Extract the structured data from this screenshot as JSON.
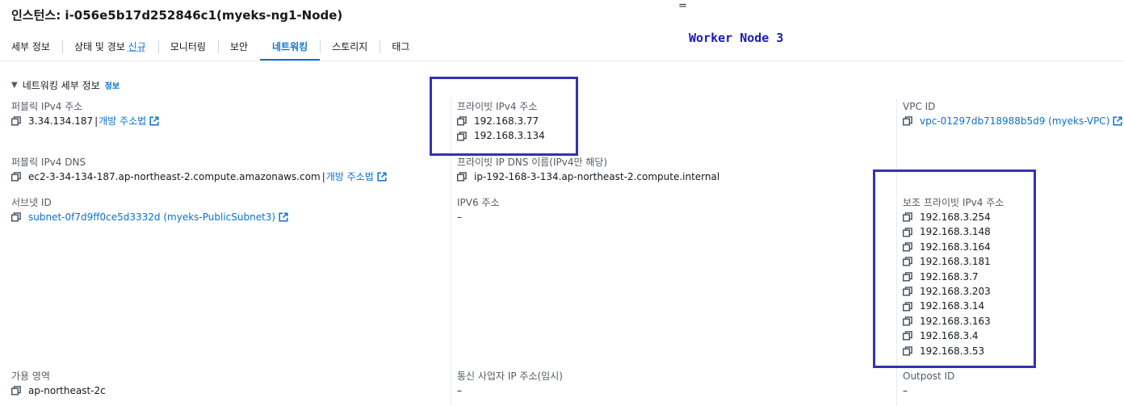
{
  "header": {
    "title": "인스턴스: i-056e5b17d252846c1(myeks-ng1-Node)",
    "top_symbol": "="
  },
  "annotation": "Worker Node 3",
  "tabs": [
    {
      "label": "세부 정보"
    },
    {
      "label": "상태 및 경보",
      "badge": "신규"
    },
    {
      "label": "모니터링"
    },
    {
      "label": "보안"
    },
    {
      "label": "네트워킹",
      "active": true
    },
    {
      "label": "스토리지"
    },
    {
      "label": "태그"
    }
  ],
  "section": {
    "title": "네트워킹 세부 정보",
    "info": "정보"
  },
  "common": {
    "open_address": "개방 주소법",
    "dash": "–"
  },
  "fields": {
    "public_ipv4": {
      "label": "퍼블릭 IPv4 주소",
      "value": "3.34.134.187"
    },
    "private_ipv4": {
      "label": "프라이빗 IPv4 주소",
      "values": [
        "192.168.3.77",
        "192.168.3.134"
      ]
    },
    "vpc_id": {
      "label": "VPC ID",
      "value": "vpc-01297db718988b5d9 (myeks-VPC)"
    },
    "public_dns": {
      "label": "퍼블릭 IPv4 DNS",
      "value": "ec2-3-34-134-187.ap-northeast-2.compute.amazonaws.com"
    },
    "private_dns": {
      "label": "프라이빗 IP DNS 이름(IPv4만 해당)",
      "value": "ip-192-168-3-134.ap-northeast-2.compute.internal"
    },
    "subnet_id": {
      "label": "서브넷 ID",
      "value": "subnet-0f7d9ff0ce5d3332d (myeks-PublicSubnet3)"
    },
    "ipv6": {
      "label": "IPV6 주소",
      "value": "–"
    },
    "secondary_private_ipv4": {
      "label": "보조 프라이빗 IPv4 주소",
      "values": [
        "192.168.3.254",
        "192.168.3.148",
        "192.168.3.164",
        "192.168.3.181",
        "192.168.3.7",
        "192.168.3.203",
        "192.168.3.14",
        "192.168.3.163",
        "192.168.3.4",
        "192.168.3.53"
      ]
    },
    "availability_zone": {
      "label": "가용 영역",
      "value": "ap-northeast-2c"
    },
    "carrier_ip": {
      "label": "통신 사업자 IP 주소(임시)",
      "value": "–"
    },
    "outpost_id": {
      "label": "Outpost ID",
      "value": "–"
    }
  },
  "colors": {
    "link": "#0972d3",
    "highlight_box": "#3232b4",
    "annotation": "#1a1ab8"
  }
}
